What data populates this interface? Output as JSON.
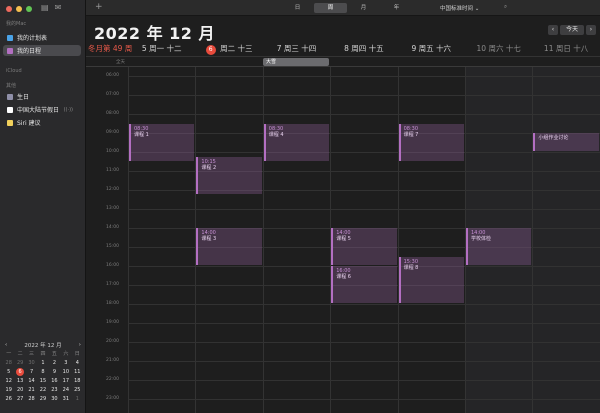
{
  "sidebar": {
    "window_controls": {
      "close": "#ed6a5e",
      "minimize": "#f5bf4f",
      "zoom": "#61c554"
    },
    "toolbar_icons": [
      "calendars-icon",
      "inbox-icon"
    ],
    "my_mac": {
      "header": "我的Mac",
      "items": [
        {
          "label": "我的计划表",
          "color": "#4aa3e8",
          "checked": true
        },
        {
          "label": "我的日程",
          "color": "#b36fc2",
          "checked": true
        }
      ]
    },
    "icloud": {
      "header": "iCloud"
    },
    "other": {
      "header": "其他",
      "items": [
        {
          "label": "生日",
          "color": "#8f8fa8",
          "checked": true
        },
        {
          "label": "中国大陆节假日",
          "color": "#ffffff",
          "checked": true,
          "extra": "((·))"
        },
        {
          "label": "Siri 建议",
          "color": "#f2d15c",
          "checked": true
        }
      ]
    }
  },
  "mini_calendar": {
    "title": "2022 年 12 月",
    "weekdays": [
      "一",
      "二",
      "三",
      "四",
      "五",
      "六",
      "日"
    ],
    "rows": [
      {
        "cells": [
          "28",
          "29",
          "30",
          "1",
          "2",
          "3",
          "4"
        ],
        "dim": [
          0,
          1,
          2
        ]
      },
      {
        "cells": [
          "5",
          "6",
          "7",
          "8",
          "9",
          "10",
          "11"
        ],
        "dim": []
      },
      {
        "cells": [
          "12",
          "13",
          "14",
          "15",
          "16",
          "17",
          "18"
        ],
        "dim": []
      },
      {
        "cells": [
          "19",
          "20",
          "21",
          "22",
          "23",
          "24",
          "25"
        ],
        "dim": []
      },
      {
        "cells": [
          "26",
          "27",
          "28",
          "29",
          "30",
          "31",
          "1"
        ],
        "dim": [
          6
        ]
      }
    ],
    "today": "6"
  },
  "toolbar": {
    "add": "+",
    "views": [
      "日",
      "周",
      "月",
      "年"
    ],
    "active_view": "周",
    "timezone": "中国标准时间",
    "timezone_chevron": "⌄",
    "search_icon": "⌕"
  },
  "header": {
    "title": "2022 年 12 月",
    "prev": "‹",
    "today": "今天",
    "next": "›",
    "week_label": "冬月第 49 周"
  },
  "days": [
    {
      "num": "5",
      "wd": "周一",
      "lunar": "十二",
      "weekend": false
    },
    {
      "num": "6",
      "wd": "周二",
      "lunar": "十三",
      "weekend": false,
      "today": true
    },
    {
      "num": "7",
      "wd": "周三",
      "lunar": "十四",
      "weekend": false
    },
    {
      "num": "8",
      "wd": "周四",
      "lunar": "十五",
      "weekend": false
    },
    {
      "num": "9",
      "wd": "周五",
      "lunar": "十六",
      "weekend": false
    },
    {
      "num": "10",
      "wd": "周六",
      "lunar": "十七",
      "weekend": true
    },
    {
      "num": "11",
      "wd": "周日",
      "lunar": "十八",
      "weekend": true
    }
  ],
  "allday": {
    "label": "全天",
    "event": {
      "title": "大雪",
      "day": 2
    }
  },
  "hours": [
    "06:00",
    "07:00",
    "08:00",
    "09:00",
    "10:00",
    "11:00",
    "12:00",
    "13:00",
    "14:00",
    "15:00",
    "16:00",
    "17:00",
    "18:00",
    "19:00",
    "20:00",
    "21:00",
    "22:00",
    "23:00",
    "00:00"
  ],
  "events": [
    {
      "day": 0,
      "start": 8.5,
      "end": 10.5,
      "time": "08:30",
      "title": "课程 1"
    },
    {
      "day": 1,
      "start": 10.25,
      "end": 12.25,
      "time": "10:15",
      "title": "课程 2"
    },
    {
      "day": 1,
      "start": 14.0,
      "end": 16.0,
      "time": "14:00",
      "title": "课程 3"
    },
    {
      "day": 2,
      "start": 8.5,
      "end": 10.5,
      "time": "08:30",
      "title": "课程 4"
    },
    {
      "day": 3,
      "start": 14.0,
      "end": 16.0,
      "time": "14:00",
      "title": "课程 5"
    },
    {
      "day": 3,
      "start": 16.0,
      "end": 18.0,
      "time": "16:00",
      "title": "课程 6"
    },
    {
      "day": 4,
      "start": 8.5,
      "end": 10.5,
      "time": "08:30",
      "title": "课程 7"
    },
    {
      "day": 4,
      "start": 15.5,
      "end": 18.0,
      "time": "15:30",
      "title": "课程 8"
    },
    {
      "day": 5,
      "start": 14.0,
      "end": 16.0,
      "time": "14:00",
      "title": "学校体检"
    },
    {
      "day": 6,
      "start": 9.0,
      "end": 10.0,
      "time": "",
      "title": "小组作业讨论"
    }
  ]
}
